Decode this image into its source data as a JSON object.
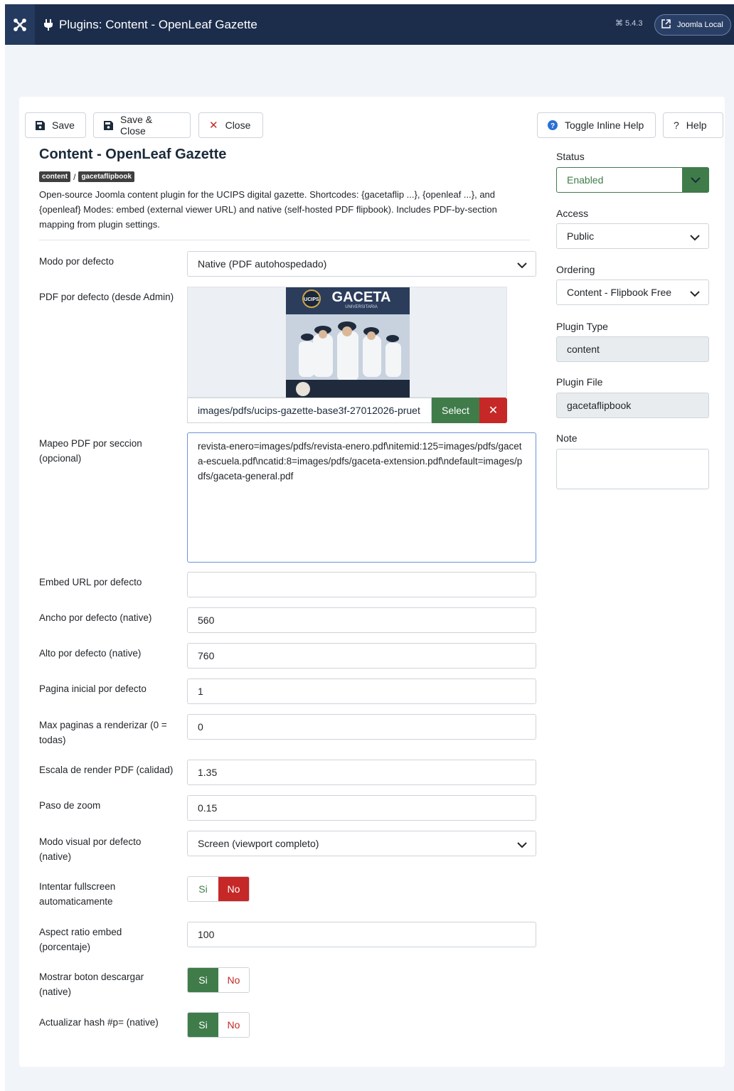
{
  "header": {
    "title": "Plugins: Content - OpenLeaf Gazette",
    "version": "5.4.3",
    "site_button": "Joomla Local"
  },
  "toolbar": {
    "save": "Save",
    "save_close": "Save & Close",
    "close": "Close",
    "toggle_help": "Toggle Inline Help",
    "help": "Help"
  },
  "main": {
    "title": "Content - OpenLeaf Gazette",
    "badge_folder": "content",
    "badge_sep": "/",
    "badge_element": "gacetaflipbook",
    "description": "Open-source Joomla content plugin for the UCIPS digital gazette. Shortcodes: {gacetaflip ...}, {openleaf ...}, and {openleaf} Modes: embed (external viewer URL) and native (self-hosted PDF flipbook). Includes PDF-by-section mapping from plugin settings."
  },
  "fields": {
    "modo": {
      "label": "Modo por defecto",
      "value": "Native (PDF autohospedado)"
    },
    "pdf": {
      "label": "PDF por defecto (desde Admin)",
      "value": "images/pdfs/ucips-gazette-base3f-27012026-pruet",
      "select": "Select",
      "cover_title": "GACETA",
      "cover_sub": "UNIVERSITARIA",
      "cover_logo": "UCIPS"
    },
    "mapeo": {
      "label": "Mapeo PDF por seccion (opcional)",
      "value": "revista-enero=images/pdfs/revista-enero.pdf\\nitemid:125=images/pdfs/gaceta-escuela.pdf\\ncatid:8=images/pdfs/gaceta-extension.pdf\\ndefault=images/pdfs/gaceta-general.pdf"
    },
    "embed_url": {
      "label": "Embed URL por defecto",
      "value": ""
    },
    "ancho": {
      "label": "Ancho por defecto (native)",
      "value": "560"
    },
    "alto": {
      "label": "Alto por defecto (native)",
      "value": "760"
    },
    "pagina": {
      "label": "Pagina inicial por defecto",
      "value": "1"
    },
    "max": {
      "label": "Max paginas a renderizar (0 = todas)",
      "value": "0"
    },
    "escala": {
      "label": "Escala de render PDF (calidad)",
      "value": "1.35"
    },
    "zoom": {
      "label": "Paso de zoom",
      "value": "0.15"
    },
    "visual": {
      "label": "Modo visual por defecto (native)",
      "value": "Screen (viewport completo)"
    },
    "fullscreen": {
      "label": "Intentar fullscreen automaticamente",
      "yes": "Si",
      "no": "No",
      "selected": "No"
    },
    "aspect": {
      "label": "Aspect ratio embed (porcentaje)",
      "value": "100"
    },
    "descargar": {
      "label": "Mostrar boton descargar (native)",
      "yes": "Si",
      "no": "No",
      "selected": "Si"
    },
    "hash": {
      "label": "Actualizar hash #p= (native)",
      "yes": "Si",
      "no": "No",
      "selected": "Si"
    }
  },
  "sidebar": {
    "status_label": "Status",
    "status_value": "Enabled",
    "access_label": "Access",
    "access_value": "Public",
    "ordering_label": "Ordering",
    "ordering_value": "Content - Flipbook Free",
    "type_label": "Plugin Type",
    "type_value": "content",
    "file_label": "Plugin File",
    "file_value": "gacetaflipbook",
    "note_label": "Note",
    "note_value": ""
  },
  "colors": {
    "header": "#1c2d4c",
    "success": "#3f7c4a",
    "danger": "#c52827"
  }
}
